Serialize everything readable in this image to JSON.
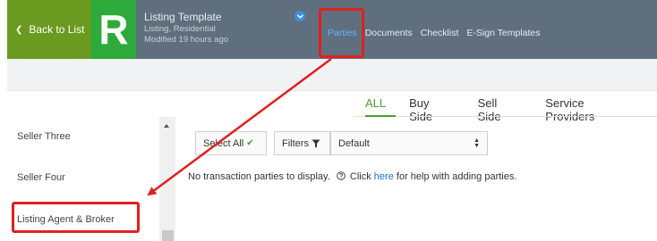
{
  "header": {
    "back_label": "Back to List",
    "logo_letter": "R",
    "listing_title": "Listing Template",
    "listing_subtitle": "Listing, Residential",
    "listing_modified": "Modified 19 hours ago",
    "nav": [
      {
        "label": "Parties",
        "active": true
      },
      {
        "label": "Documents",
        "active": false
      },
      {
        "label": "Checklist",
        "active": false
      },
      {
        "label": "E-Sign Templates",
        "active": false
      }
    ]
  },
  "tabs": [
    {
      "label": "ALL",
      "active": true
    },
    {
      "label": "Buy Side",
      "active": false
    },
    {
      "label": "Sell Side",
      "active": false
    },
    {
      "label": "Service Providers",
      "active": false
    }
  ],
  "sidebar": {
    "items": [
      "Seller Three",
      "Seller Four",
      "Listing Agent & Broker"
    ]
  },
  "toolbar": {
    "select_all_label": "Select All",
    "filters_label": "Filters",
    "default_select_value": "Default"
  },
  "empty_state": {
    "message_before": "No transaction parties to display.",
    "message_click": "Click",
    "help_link": "here",
    "message_after": "for help with adding parties."
  },
  "colors": {
    "topbar": "#5f6f7d",
    "back_button": "#6a9a1f",
    "logo_bg": "#2eaa3a",
    "accent_green": "#45a12e",
    "nav_active": "#5fb4ff",
    "annotation_red": "#e02020",
    "link_blue": "#1a6fd0"
  },
  "icons": {
    "back": "chevron-left-icon",
    "dropdown": "chevron-down-icon",
    "select_all": "checkmark-icon",
    "filters": "filter-icon",
    "sort": "sort-updown-icon",
    "help": "question-circle-icon"
  }
}
